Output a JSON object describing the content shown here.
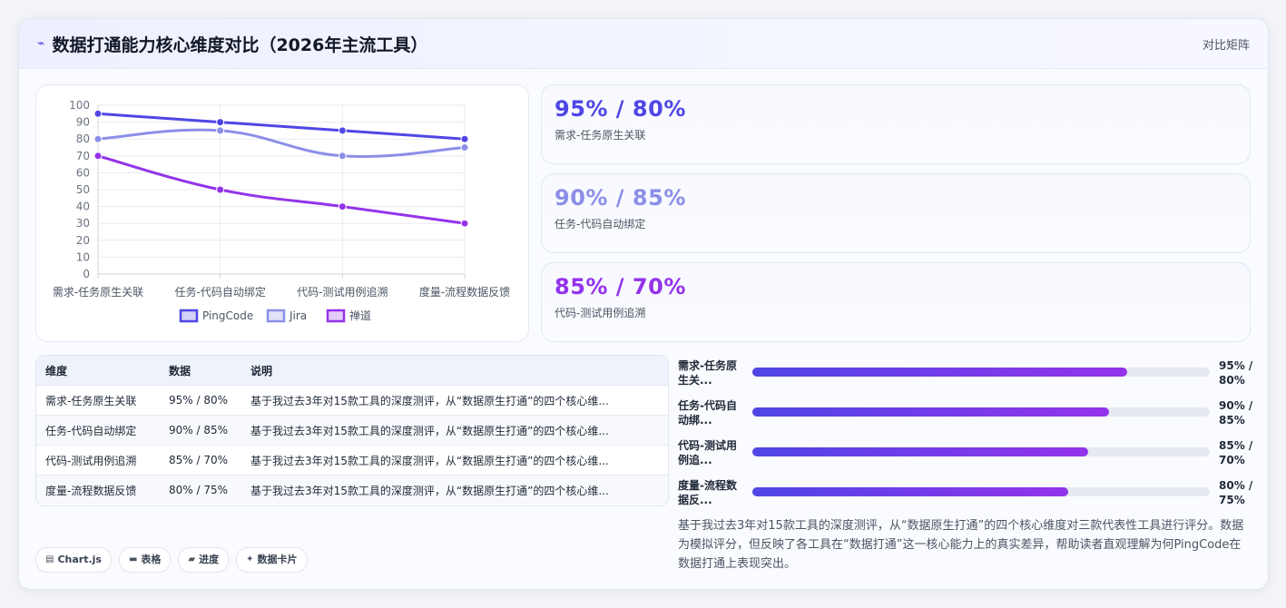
{
  "header": {
    "title_icon": "chart-line-icon",
    "title": "数据打通能力核心维度对比（2026年主流工具）",
    "right_label": "对比矩阵"
  },
  "colors": {
    "pingcode": "#4f46e5",
    "jira": "#8b8fe8",
    "chandao": "#9333ea",
    "bar_start": "#4f46e5",
    "bar_end": "#9333ea"
  },
  "chart_data": {
    "type": "line",
    "categories": [
      "需求-任务原生关联",
      "任务-代码自动绑定",
      "代码-测试用例追溯",
      "度量-流程数据反馈"
    ],
    "series": [
      {
        "name": "PingCode",
        "values": [
          95,
          90,
          85,
          80
        ]
      },
      {
        "name": "Jira",
        "values": [
          80,
          85,
          70,
          75
        ]
      },
      {
        "name": "禅道",
        "values": [
          70,
          50,
          40,
          30
        ]
      }
    ],
    "yticks": [
      "0",
      "10",
      "20",
      "30",
      "40",
      "50",
      "60",
      "70",
      "80",
      "90",
      "100"
    ],
    "ylim": [
      0,
      100
    ],
    "grid": true,
    "legend": "bottom"
  },
  "stats": [
    {
      "value": "95% / 80%",
      "label": "需求-任务原生关联"
    },
    {
      "value": "90% / 85%",
      "label": "任务-代码自动绑定"
    },
    {
      "value": "85% / 70%",
      "label": "代码-测试用例追溯"
    }
  ],
  "table": {
    "headers": [
      "维度",
      "数据",
      "说明"
    ],
    "rows": [
      [
        "需求-任务原生关联",
        "95% / 80%",
        "基于我过去3年对15款工具的深度测评，从“数据原生打通”的四个核心维..."
      ],
      [
        "任务-代码自动绑定",
        "90% / 85%",
        "基于我过去3年对15款工具的深度测评，从“数据原生打通”的四个核心维..."
      ],
      [
        "代码-测试用例追溯",
        "85% / 70%",
        "基于我过去3年对15款工具的深度测评，从“数据原生打通”的四个核心维..."
      ],
      [
        "度量-流程数据反馈",
        "80% / 75%",
        "基于我过去3年对15款工具的深度测评，从“数据原生打通”的四个核心维..."
      ]
    ]
  },
  "progress": [
    {
      "label_line1": "需求-任务原",
      "label_line2": "生关...",
      "value_line1": "95% /",
      "value_line2": "80%",
      "fill": 0.82
    },
    {
      "label_line1": "任务-代码自",
      "label_line2": "动绑...",
      "value_line1": "90% /",
      "value_line2": "85%",
      "fill": 0.78
    },
    {
      "label_line1": "代码-测试用",
      "label_line2": "例追...",
      "value_line1": "85% /",
      "value_line2": "70%",
      "fill": 0.735
    },
    {
      "label_line1": "度量-流程数",
      "label_line2": "据反...",
      "value_line1": "80% /",
      "value_line2": "75%",
      "fill": 0.69
    }
  ],
  "description": "基于我过去3年对15款工具的深度测评，从“数据原生打通”的四个核心维度对三款代表性工具进行评分。数据为模拟评分，但反映了各工具在“数据打通”这一核心能力上的真实差异，帮助读者直观理解为何PingCode在数据打通上表现突出。",
  "chips": [
    {
      "icon": "chart-icon",
      "glyph": "▤",
      "label": "Chart.js"
    },
    {
      "icon": "table-icon",
      "glyph": "▬",
      "label": "表格"
    },
    {
      "icon": "progress-icon",
      "glyph": "▰",
      "label": "进度"
    },
    {
      "icon": "sparkle-icon",
      "glyph": "✦",
      "label": "数据卡片"
    }
  ]
}
